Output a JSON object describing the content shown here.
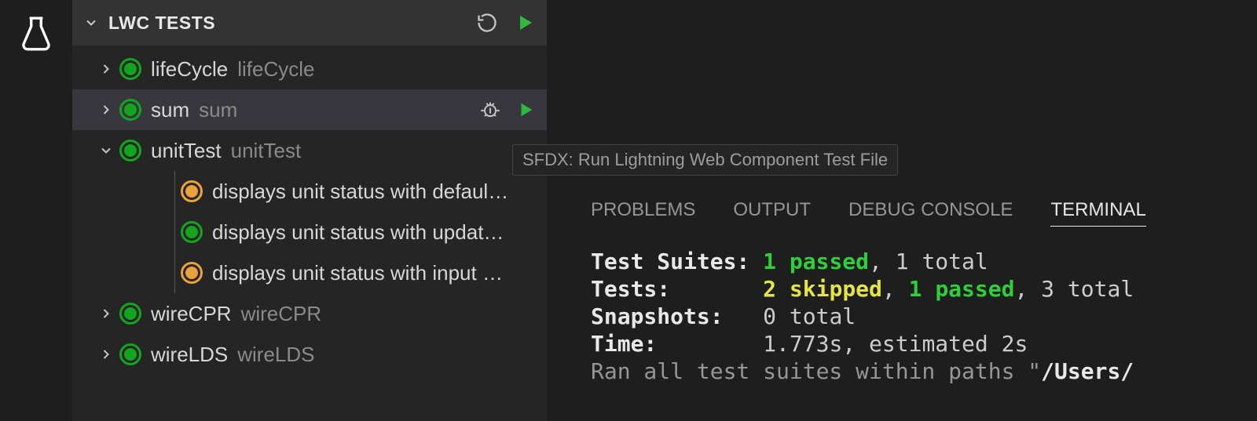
{
  "sidebar": {
    "section_title": "LWC TESTS",
    "items": [
      {
        "label": "lifeCycle",
        "sub": "lifeCycle",
        "status": "green",
        "expanded": false,
        "hovered": false,
        "depth": 1,
        "hasChevron": true,
        "chevronDown": false,
        "hasActions": false
      },
      {
        "label": "sum",
        "sub": "sum",
        "status": "green",
        "expanded": false,
        "hovered": true,
        "depth": 1,
        "hasChevron": true,
        "chevronDown": false,
        "hasActions": true
      },
      {
        "label": "unitTest",
        "sub": "unitTest",
        "status": "green",
        "expanded": true,
        "hovered": false,
        "depth": 1,
        "hasChevron": true,
        "chevronDown": true,
        "hasActions": false
      },
      {
        "label": "displays unit status with defaul…",
        "sub": "",
        "status": "orange",
        "expanded": false,
        "hovered": false,
        "depth": 2,
        "hasChevron": false,
        "chevronDown": false,
        "hasActions": false
      },
      {
        "label": "displays unit status with updat…",
        "sub": "",
        "status": "green",
        "expanded": false,
        "hovered": false,
        "depth": 2,
        "hasChevron": false,
        "chevronDown": false,
        "hasActions": false
      },
      {
        "label": "displays unit status with input …",
        "sub": "",
        "status": "orange",
        "expanded": false,
        "hovered": false,
        "depth": 2,
        "hasChevron": false,
        "chevronDown": false,
        "hasActions": false
      },
      {
        "label": "wireCPR",
        "sub": "wireCPR",
        "status": "green",
        "expanded": false,
        "hovered": false,
        "depth": 1,
        "hasChevron": true,
        "chevronDown": false,
        "hasActions": false
      },
      {
        "label": "wireLDS",
        "sub": "wireLDS",
        "status": "green",
        "expanded": false,
        "hovered": false,
        "depth": 1,
        "hasChevron": true,
        "chevronDown": false,
        "hasActions": false
      }
    ]
  },
  "tooltip": "SFDX: Run Lightning Web Component Test File",
  "panel": {
    "tabs": [
      "PROBLEMS",
      "OUTPUT",
      "DEBUG CONSOLE",
      "TERMINAL"
    ],
    "active": "TERMINAL"
  },
  "terminal": {
    "lines": {
      "suites_label": "Test Suites:",
      "suites_pass": "1 passed",
      "suites_rest": ", 1 total",
      "tests_label": "Tests:",
      "tests_skipped": "2 skipped",
      "tests_pass": "1 passed",
      "tests_rest_a": ", ",
      "tests_rest_b": ", 3 total",
      "snapshots_label": "Snapshots:",
      "snapshots_val": "0 total",
      "time_label": "Time:",
      "time_val": "1.773s, estimated 2s",
      "ran_prefix": "Ran all test suites within paths \"",
      "ran_path": "/Users/"
    }
  }
}
